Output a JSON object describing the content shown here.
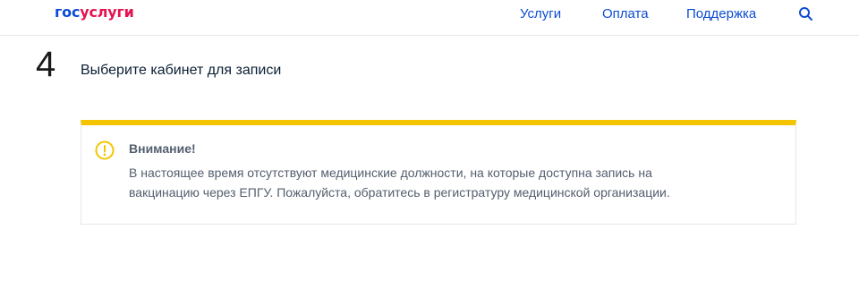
{
  "header": {
    "logo_part1": "гос",
    "logo_part2": "услуги",
    "nav": {
      "services": "Услуги",
      "payment": "Оплата",
      "support": "Поддержка"
    },
    "search_icon": "search-icon"
  },
  "step": {
    "number": "4",
    "title": "Выберите кабинет для записи"
  },
  "alert": {
    "icon": "warning-icon",
    "title": "Внимание!",
    "line1": "В настоящее время отсутствуют медицинские должности, на которые доступна запись на",
    "line2": "вакцинацию через ЕПГУ. Пожалуйста, обратитесь в регистратуру медицинской организации."
  },
  "colors": {
    "brand_blue": "#0d4cd3",
    "brand_red": "#e4134f",
    "alert_accent": "#f5c400",
    "text_secondary": "#535e6e"
  }
}
